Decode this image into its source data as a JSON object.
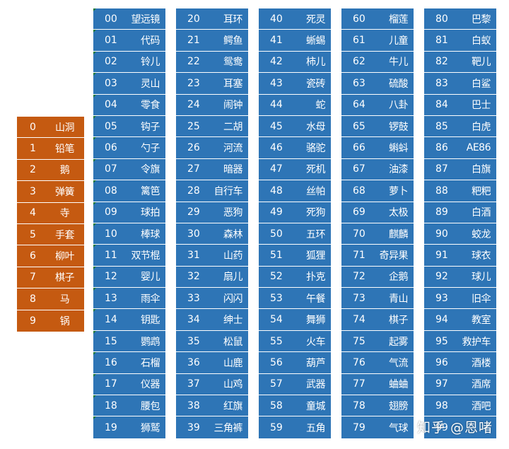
{
  "colors": {
    "blue": "#2e75b6",
    "orange": "#c55a11"
  },
  "digits": [
    {
      "num": "0",
      "word": "山洞"
    },
    {
      "num": "1",
      "word": "铅笔"
    },
    {
      "num": "2",
      "word": "鹅"
    },
    {
      "num": "3",
      "word": "弹簧"
    },
    {
      "num": "4",
      "word": "寺"
    },
    {
      "num": "5",
      "word": "手套"
    },
    {
      "num": "6",
      "word": "柳叶"
    },
    {
      "num": "7",
      "word": "棋子"
    },
    {
      "num": "8",
      "word": "马"
    },
    {
      "num": "9",
      "word": "锅"
    }
  ],
  "columns": [
    [
      {
        "num": "00",
        "word": "望远镜"
      },
      {
        "num": "01",
        "word": "代码"
      },
      {
        "num": "02",
        "word": "铃儿"
      },
      {
        "num": "03",
        "word": "灵山"
      },
      {
        "num": "04",
        "word": "零食"
      },
      {
        "num": "05",
        "word": "钩子"
      },
      {
        "num": "06",
        "word": "勺子"
      },
      {
        "num": "07",
        "word": "令旗"
      },
      {
        "num": "08",
        "word": "篱笆"
      },
      {
        "num": "09",
        "word": "球拍"
      },
      {
        "num": "10",
        "word": "棒球"
      },
      {
        "num": "11",
        "word": "双节棍"
      },
      {
        "num": "12",
        "word": "婴儿"
      },
      {
        "num": "13",
        "word": "雨伞"
      },
      {
        "num": "14",
        "word": "钥匙"
      },
      {
        "num": "15",
        "word": "鹦鹉"
      },
      {
        "num": "16",
        "word": "石榴"
      },
      {
        "num": "17",
        "word": "仪器"
      },
      {
        "num": "18",
        "word": "腰包"
      },
      {
        "num": "19",
        "word": "狮鹫"
      }
    ],
    [
      {
        "num": "20",
        "word": "耳环"
      },
      {
        "num": "21",
        "word": "鳄鱼"
      },
      {
        "num": "22",
        "word": "鸳鸯"
      },
      {
        "num": "23",
        "word": "耳塞"
      },
      {
        "num": "24",
        "word": "闹钟"
      },
      {
        "num": "25",
        "word": "二胡"
      },
      {
        "num": "26",
        "word": "河流"
      },
      {
        "num": "27",
        "word": "暗器"
      },
      {
        "num": "28",
        "word": "自行车"
      },
      {
        "num": "29",
        "word": "恶狗"
      },
      {
        "num": "30",
        "word": "森林"
      },
      {
        "num": "31",
        "word": "山药"
      },
      {
        "num": "32",
        "word": "扇儿"
      },
      {
        "num": "33",
        "word": "闪闪"
      },
      {
        "num": "34",
        "word": "绅士"
      },
      {
        "num": "35",
        "word": "松鼠"
      },
      {
        "num": "36",
        "word": "山鹿"
      },
      {
        "num": "37",
        "word": "山鸡"
      },
      {
        "num": "38",
        "word": "红旗"
      },
      {
        "num": "39",
        "word": "三角裤"
      }
    ],
    [
      {
        "num": "40",
        "word": "死灵"
      },
      {
        "num": "41",
        "word": "蜥蜴"
      },
      {
        "num": "42",
        "word": "柿儿"
      },
      {
        "num": "43",
        "word": "瓷砖"
      },
      {
        "num": "44",
        "word": "蛇"
      },
      {
        "num": "45",
        "word": "水母"
      },
      {
        "num": "46",
        "word": "骆驼"
      },
      {
        "num": "47",
        "word": "死机"
      },
      {
        "num": "48",
        "word": "丝帕"
      },
      {
        "num": "49",
        "word": "死狗"
      },
      {
        "num": "50",
        "word": "五环"
      },
      {
        "num": "51",
        "word": "狐狸"
      },
      {
        "num": "52",
        "word": "扑克"
      },
      {
        "num": "53",
        "word": "午餐"
      },
      {
        "num": "54",
        "word": "舞狮"
      },
      {
        "num": "55",
        "word": "火车"
      },
      {
        "num": "56",
        "word": "葫芦"
      },
      {
        "num": "57",
        "word": "武器"
      },
      {
        "num": "58",
        "word": "童城"
      },
      {
        "num": "59",
        "word": "五角"
      }
    ],
    [
      {
        "num": "60",
        "word": "榴莲"
      },
      {
        "num": "61",
        "word": "儿童"
      },
      {
        "num": "62",
        "word": "牛儿"
      },
      {
        "num": "63",
        "word": "硫酸"
      },
      {
        "num": "64",
        "word": "八卦"
      },
      {
        "num": "65",
        "word": "锣鼓"
      },
      {
        "num": "66",
        "word": "蝌蚪"
      },
      {
        "num": "67",
        "word": "油漆"
      },
      {
        "num": "68",
        "word": "萝卜"
      },
      {
        "num": "69",
        "word": "太极"
      },
      {
        "num": "70",
        "word": "麒麟"
      },
      {
        "num": "71",
        "word": "奇异果"
      },
      {
        "num": "72",
        "word": "企鹅"
      },
      {
        "num": "73",
        "word": "青山"
      },
      {
        "num": "74",
        "word": "棋子"
      },
      {
        "num": "75",
        "word": "起雾"
      },
      {
        "num": "76",
        "word": "气流"
      },
      {
        "num": "77",
        "word": "蛐蛐"
      },
      {
        "num": "78",
        "word": "翅膀"
      },
      {
        "num": "79",
        "word": "气球"
      }
    ],
    [
      {
        "num": "80",
        "word": "巴黎"
      },
      {
        "num": "81",
        "word": "白蚁"
      },
      {
        "num": "82",
        "word": "靶儿"
      },
      {
        "num": "83",
        "word": "白鲨"
      },
      {
        "num": "84",
        "word": "巴士"
      },
      {
        "num": "85",
        "word": "白虎"
      },
      {
        "num": "86",
        "word": "AE86"
      },
      {
        "num": "87",
        "word": "白旗"
      },
      {
        "num": "88",
        "word": "粑粑"
      },
      {
        "num": "89",
        "word": "白酒"
      },
      {
        "num": "90",
        "word": "蛟龙"
      },
      {
        "num": "91",
        "word": "球衣"
      },
      {
        "num": "92",
        "word": "球儿"
      },
      {
        "num": "93",
        "word": "旧伞"
      },
      {
        "num": "94",
        "word": "教室"
      },
      {
        "num": "95",
        "word": "救护车"
      },
      {
        "num": "96",
        "word": "酒楼"
      },
      {
        "num": "97",
        "word": "酒席"
      },
      {
        "num": "98",
        "word": "酒吧"
      },
      {
        "num": "99",
        "word": ""
      }
    ]
  ],
  "watermark": "知乎 @恩啫"
}
